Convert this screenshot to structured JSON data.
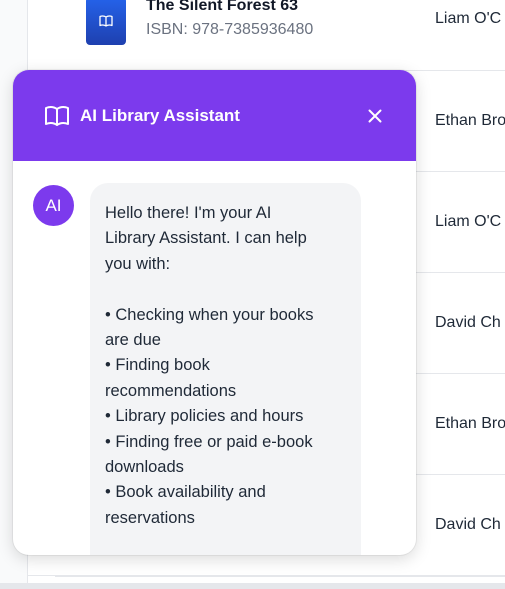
{
  "table": {
    "rows": [
      {
        "title": "The Silent Forest 63",
        "isbn": "ISBN: 978-7385936480",
        "author": "Liam O'C"
      },
      {
        "author": "Ethan Bro"
      },
      {
        "author": "Liam O'C"
      },
      {
        "author": "David Ch"
      },
      {
        "author": "Ethan Bro"
      },
      {
        "author": "David Ch"
      }
    ],
    "colors": {
      "cover": "#2563eb",
      "border": "#e5e7eb"
    }
  },
  "chat": {
    "title": "AI Library Assistant",
    "accent": "#7c3aed",
    "avatar_label": "AI",
    "message": "Hello there! I'm your AI\nLibrary Assistant. I can help\nyou with:\n\n• Checking when your books\nare due\n• Finding book\nrecommendations\n• Library policies and hours\n• Finding free or paid e-book\ndownloads\n• Book availability and\nreservations\n\nHow can I assist you today?",
    "icons": {
      "header": "book-open-icon",
      "close": "close-icon",
      "cover": "book-icon"
    }
  }
}
